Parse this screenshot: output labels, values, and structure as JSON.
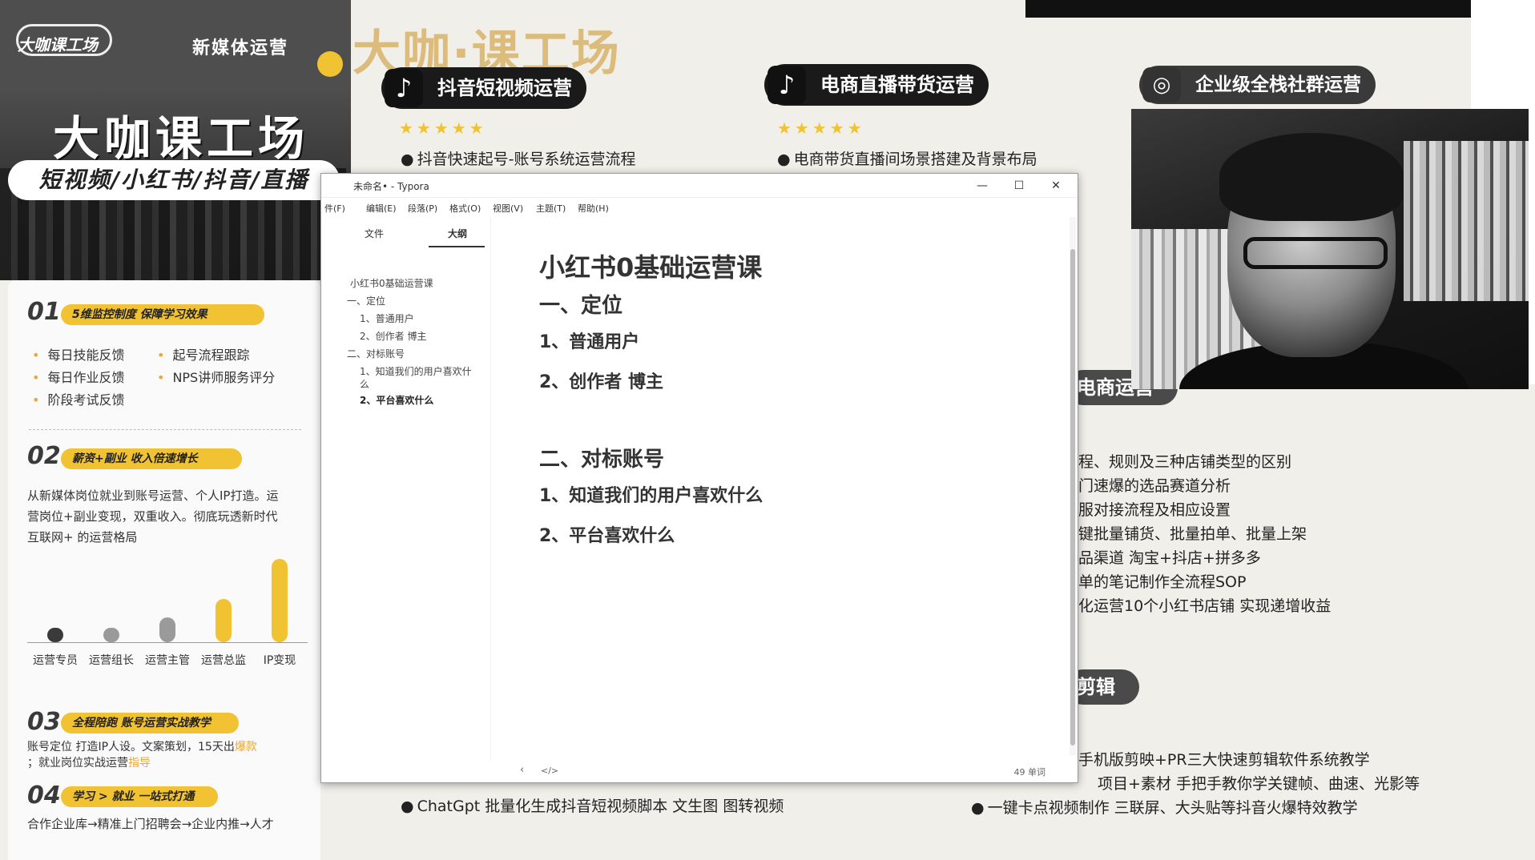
{
  "left_banner": {
    "logo": "大咖课工场",
    "media_label": "新媒体运营",
    "brand": "大咖课工场",
    "tags": "短视频/小红书/抖音/直播"
  },
  "left_card": {
    "sec1": {
      "num": "01",
      "title": "5维监控制度 保障学习效果",
      "bullets": [
        "每日技能反馈",
        "起号流程跟踪",
        "每日作业反馈",
        "NPS讲师服务评分",
        "阶段考试反馈"
      ]
    },
    "sec2": {
      "num": "02",
      "title": "薪资+副业 收入倍速增长",
      "para": [
        "从新媒体岗位就业到账号运营、个人IP打造。运",
        "营岗位+副业变现，双重收入。彻底玩透新时代",
        "互联网+ 的运营格局"
      ],
      "bars": [
        {
          "label": "运营专员",
          "level": 0.06,
          "color": "#3a3a3a"
        },
        {
          "label": "运营组长",
          "level": 0.12,
          "color": "#9a9a9a"
        },
        {
          "label": "运营主管",
          "level": 0.3,
          "color": "#9a9a9a"
        },
        {
          "label": "运营总监",
          "level": 0.52,
          "color": "#f1c232"
        },
        {
          "label": "IP变现",
          "level": 1.0,
          "color": "#f1c232"
        }
      ]
    },
    "sec3": {
      "num": "03",
      "title": "全程陪跑 账号运营实战教学",
      "para1": "账号定位 打造IP人设。文案策划，15天出",
      "para1_hl": "爆款",
      "para2": "；就业岗位实战运营",
      "para2_hl": "指导"
    },
    "sec4": {
      "num": "04",
      "title": "学习 > 就业 一站式打通",
      "para": "合作企业库→精准上门招聘会→企业内推→人才"
    }
  },
  "courses": {
    "big_title": "大咖·课工场",
    "douyin": {
      "title": "抖音短视频运营",
      "stars": "★★★★★",
      "line": "抖音快速起号-账号系统运营流程"
    },
    "ecommerce_live": {
      "title": "电商直播带货运营",
      "stars": "★★★★★",
      "line": "电商带货直播间场景搭建及背景布局"
    },
    "community": {
      "title": "企业级全栈社群运营"
    },
    "bottom_line": "ChatGpt 批量化生成抖音短视频脚本 文生图 图转视频"
  },
  "right_panel": {
    "ecommerce_pill": "电商运营",
    "ecommerce_lines": [
      "程、规则及三种店铺类型的区别",
      "门速爆的选品赛道分析",
      "服对接流程及相应设置",
      "键批量铺货、批量拍单、批量上架",
      "品渠道 淘宝+抖店+拼多多",
      "单的笔记制作全流程SOP",
      "化运营10个小红书店铺 实现递增收益"
    ],
    "editing_pill": "剪辑",
    "editing_lines": [
      "手机版剪映+PR三大快速剪辑软件系统教学",
      "项目+素材 手把手教你学关键帧、曲速、光影等",
      "一键卡点视频制作 三联屏、大头贴等抖音火爆特效教学"
    ]
  },
  "typora": {
    "title": "未命名• - Typora",
    "menu": [
      "编辑(E)",
      "段落(P)",
      "格式(O)",
      "视图(V)",
      "主题(T)",
      "帮助(H)"
    ],
    "menu_first": "件(F)",
    "tabs": {
      "files": "文件",
      "outline": "大纲"
    },
    "outline": [
      {
        "text": "小红书0基础运营课",
        "level": 0
      },
      {
        "text": "一、定位",
        "level": 1
      },
      {
        "text": "1、普通用户",
        "level": 2
      },
      {
        "text": "2、创作者 博主",
        "level": 2
      },
      {
        "text": "二、对标账号",
        "level": 1
      },
      {
        "text": "1、知道我们的用户喜欢什",
        "level": 2
      },
      {
        "text": "么",
        "level": 2
      },
      {
        "text": "2、平台喜欢什么",
        "level": 2
      }
    ],
    "doc": {
      "h1": "小红书0基础运营课",
      "h2a": "一、定位",
      "p1": "1、普通用户",
      "p2": "2、创作者 博主",
      "h2b": "二、对标账号",
      "p3": "1、知道我们的用户喜欢什么",
      "p4": "2、平台喜欢什么"
    },
    "status": {
      "back": "‹",
      "source": "</>",
      "words": "49 单词"
    },
    "controls": {
      "minimize": "—",
      "maximize": "☐",
      "close": "✕"
    }
  }
}
